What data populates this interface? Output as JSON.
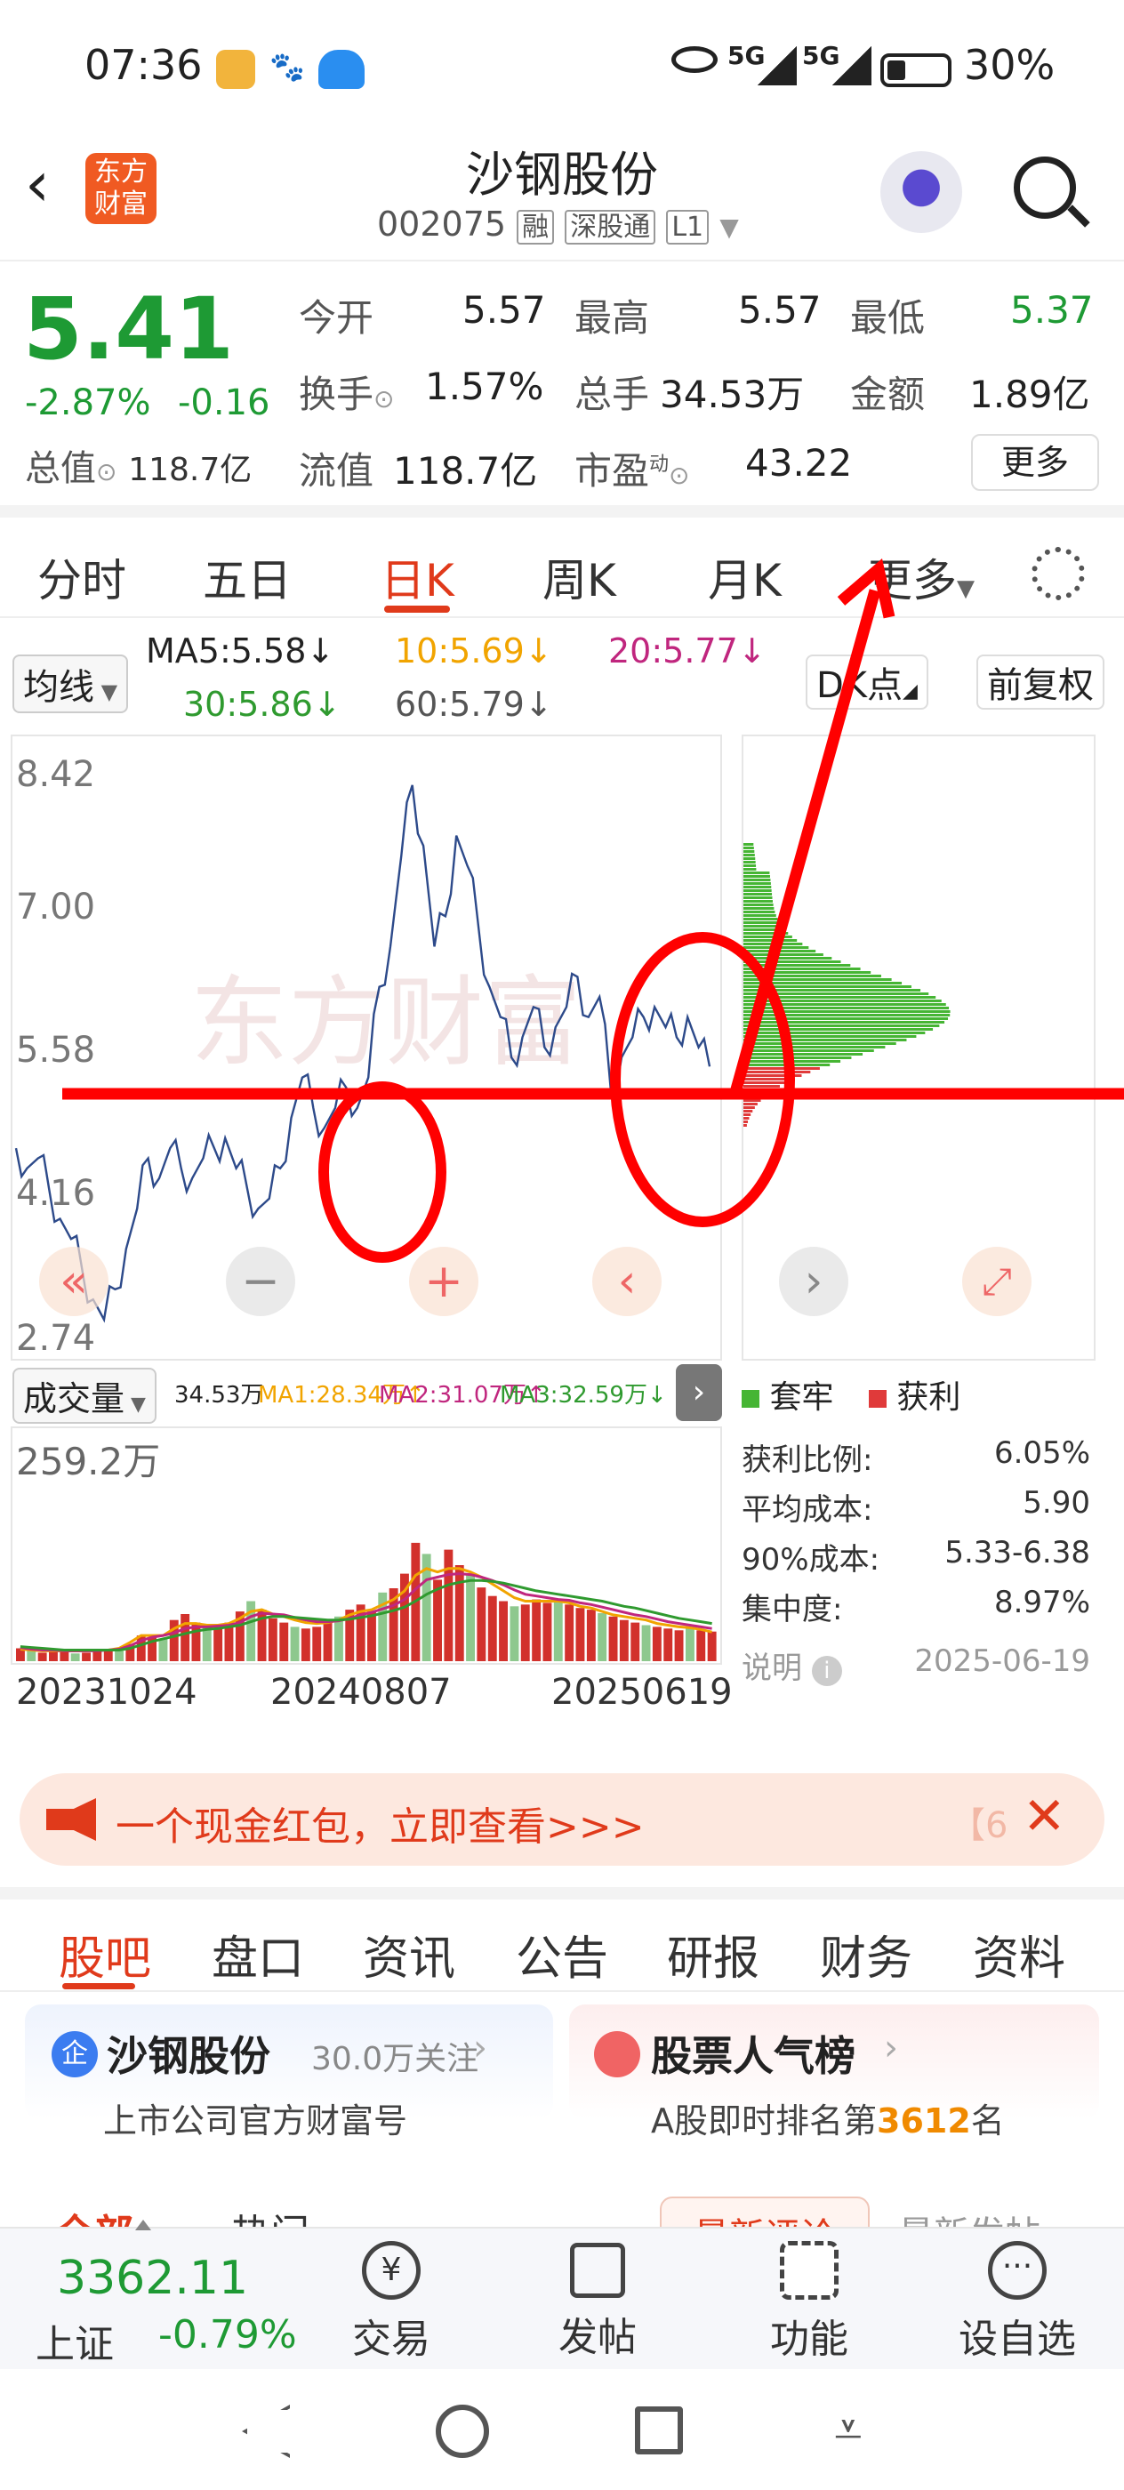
{
  "status": {
    "time": "07:36",
    "net1": "5G",
    "net2": "5G",
    "battery": "30%"
  },
  "header": {
    "title": "沙钢股份",
    "code": "002075",
    "tag1": "融",
    "tag2": "深股通",
    "tag3": "L1",
    "logo_text_top": "东方",
    "logo_text_bottom": "财富"
  },
  "quote": {
    "price": "5.41",
    "change_pct": "-2.87%",
    "change": "-0.16",
    "open_label": "今开",
    "open": "5.57",
    "high_label": "最高",
    "high": "5.57",
    "low_label": "最低",
    "low": "5.37",
    "turnover_label": "换手",
    "turnover": "1.57%",
    "volume_label": "总手",
    "volume": "34.53万",
    "amount_label": "金额",
    "amount": "1.89亿",
    "mktcap_label": "总值",
    "mktcap": "118.7亿",
    "float_label": "流值",
    "float": "118.7亿",
    "pe_label": "市盈",
    "pe_sup": "动",
    "pe": "43.22",
    "more": "更多"
  },
  "tabs": [
    "分时",
    "五日",
    "日K",
    "周K",
    "月K",
    "更多"
  ],
  "ma": {
    "selector": "均线",
    "ma5": "MA5:5.58↓",
    "ma10": "10:5.69↓",
    "ma20": "20:5.77↓",
    "ma30": "30:5.86↓",
    "ma60": "60:5.79↓",
    "dk": "DK点",
    "fq": "前复权"
  },
  "chart_data": [
    {
      "type": "line",
      "title": "",
      "yticks": [
        "8.42",
        "7.00",
        "5.58",
        "4.16",
        "2.74"
      ],
      "ylim": [
        2.74,
        8.42
      ],
      "x": [
        "20231024",
        "20240807",
        "20250619"
      ],
      "series": [
        {
          "values": [
            4.6,
            4.4,
            4.5,
            4.2,
            3.9,
            3.7,
            3.4,
            3.1,
            2.9,
            3.2,
            3.6,
            4.0,
            4.5,
            4.3,
            4.6,
            4.4,
            4.3,
            4.5,
            4.6,
            4.7,
            4.4,
            4.2,
            4.0,
            4.1,
            4.4,
            4.9,
            5.3,
            5.0,
            4.8,
            5.0,
            5.2,
            5.0,
            5.3,
            6.2,
            6.6,
            7.5,
            8.2,
            7.6,
            6.6,
            6.9,
            7.7,
            7.4,
            6.8,
            6.2,
            5.9,
            5.5,
            5.7,
            6.0,
            5.6,
            5.8,
            6.0,
            6.3,
            5.9,
            6.1,
            5.2,
            5.5,
            5.7,
            5.9,
            6.0,
            5.8,
            5.7,
            5.9,
            5.6,
            5.41
          ]
        }
      ]
    },
    {
      "type": "bar",
      "yticks": [
        "259.2万"
      ],
      "x": [
        "20231024",
        "20240807",
        "20250619"
      ],
      "ylim": [
        0,
        259.2
      ],
      "series": [
        {
          "name": "成交量",
          "values": [
            15,
            12,
            10,
            14,
            12,
            9,
            10,
            14,
            12,
            12,
            20,
            30,
            28,
            26,
            48,
            55,
            45,
            40,
            38,
            45,
            58,
            70,
            60,
            50,
            45,
            40,
            38,
            40,
            45,
            52,
            60,
            66,
            58,
            80,
            85,
            102,
            138,
            125,
            95,
            130,
            112,
            100,
            86,
            76,
            70,
            64,
            66,
            72,
            68,
            70,
            66,
            62,
            60,
            56,
            52,
            48,
            45,
            42,
            40,
            38,
            36,
            40,
            36,
            34.53
          ]
        },
        {
          "name": "MA1:28.34万↑",
          "values": [
            14,
            13,
            12,
            12,
            12,
            12,
            12,
            13,
            13,
            15,
            22,
            30,
            30,
            30,
            38,
            44,
            44,
            42,
            42,
            44,
            50,
            58,
            60,
            55,
            52,
            48,
            45,
            44,
            45,
            48,
            54,
            58,
            60,
            66,
            72,
            82,
            100,
            108,
            104,
            108,
            108,
            104,
            98,
            90,
            82,
            74,
            70,
            70,
            70,
            70,
            68,
            64,
            62,
            58,
            54,
            52,
            50,
            48,
            44,
            42,
            40,
            39,
            37,
            34
          ]
        },
        {
          "name": "MA2:31.07万↑",
          "values": [
            16,
            14,
            13,
            13,
            12,
            12,
            12,
            12,
            13,
            14,
            18,
            24,
            28,
            30,
            33,
            38,
            40,
            40,
            41,
            42,
            45,
            52,
            56,
            55,
            54,
            51,
            48,
            46,
            46,
            47,
            50,
            54,
            57,
            61,
            65,
            72,
            84,
            95,
            98,
            101,
            102,
            101,
            98,
            94,
            89,
            83,
            78,
            76,
            74,
            72,
            71,
            68,
            66,
            63,
            60,
            57,
            54,
            52,
            49,
            46,
            44,
            42,
            40,
            38
          ]
        },
        {
          "name": "MA3:32.59万↓",
          "values": [
            17,
            16,
            15,
            14,
            13,
            13,
            13,
            13,
            13,
            13,
            15,
            19,
            23,
            26,
            29,
            32,
            35,
            37,
            38,
            40,
            42,
            46,
            50,
            52,
            52,
            51,
            50,
            49,
            48,
            48,
            49,
            51,
            53,
            56,
            59,
            63,
            70,
            78,
            84,
            89,
            92,
            94,
            94,
            93,
            91,
            88,
            85,
            82,
            80,
            78,
            76,
            74,
            72,
            70,
            67,
            64,
            62,
            59,
            56,
            53,
            50,
            48,
            46,
            44
          ]
        }
      ]
    }
  ],
  "volume": {
    "selector": "成交量",
    "current": "34.53万",
    "ma1": "MA1:28.34万↑",
    "ma2": "MA2:31.07万↑",
    "ma3": "MA3:32.59万↓"
  },
  "chips": {
    "legend_trapped": "套牢",
    "legend_profit": "获利",
    "rows": [
      {
        "label": "获利比例:",
        "value": "6.05%"
      },
      {
        "label": "平均成本:",
        "value": "5.90"
      },
      {
        "label": "90%成本:",
        "value": "5.33-6.38"
      },
      {
        "label": "集中度:",
        "value": "8.97%"
      }
    ],
    "note": "说明",
    "date": "2025-06-19"
  },
  "banner": {
    "text": "一个现金红包，立即查看>>>",
    "countdown": "【6"
  },
  "subtabs": [
    "股吧",
    "盘口",
    "资讯",
    "公告",
    "研报",
    "财务",
    "资料"
  ],
  "cards": {
    "left_title": "沙钢股份",
    "left_followers": "30.0万关注",
    "left_sub": "上市公司官方财富号",
    "right_title": "股票人气榜",
    "right_sub_pre": "A股即时排名第",
    "right_rank": "3612",
    "right_sub_post": "名"
  },
  "partial_tabs": {
    "a": "全部",
    "b": "热门",
    "c": "最新评论",
    "d": "最新发帖"
  },
  "bottom": {
    "index_value": "3362.11",
    "index_name": "上证",
    "index_change": "-0.79%",
    "trade": "交易",
    "post": "发帖",
    "func": "功能",
    "watch": "设自选"
  },
  "colors": {
    "accent": "#e03a1b",
    "up_red": "#e03a1b",
    "down_green": "#1e9a34",
    "line": "#2d4a8a",
    "annotation": "#ff0000"
  }
}
